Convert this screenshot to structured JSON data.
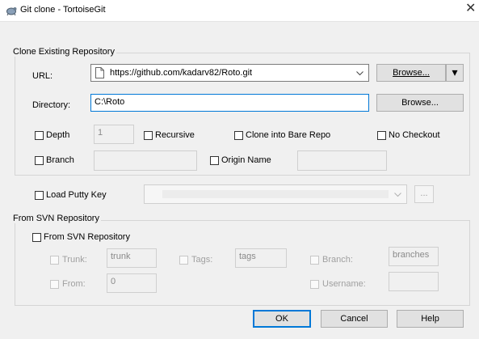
{
  "window": {
    "title": "Git clone - TortoiseGit",
    "close_glyph": "✕"
  },
  "clone": {
    "group_label": "Clone Existing Repository",
    "url_label": "URL:",
    "url_value": "https://github.com/kadarv82/Roto.git",
    "browse_main": "Browse...",
    "browse_split": "▾",
    "directory_label": "Directory:",
    "directory_value": "C:\\Roto",
    "browse_directory": "Browse...",
    "depth_label": "Depth",
    "depth_value": "1",
    "recursive_label": "Recursive",
    "bare_label": "Clone into Bare Repo",
    "nocheckout_label": "No Checkout",
    "branch_label": "Branch",
    "branch_value": "",
    "origin_label": "Origin Name",
    "origin_value": ""
  },
  "putty": {
    "label": "Load Putty Key",
    "value": "",
    "browse": "..."
  },
  "svn": {
    "group_label": "From SVN Repository",
    "checkbox_label": "From SVN Repository",
    "trunk_label": "Trunk:",
    "trunk_value": "trunk",
    "tags_label": "Tags:",
    "tags_value": "tags",
    "branch_label": "Branch:",
    "branch_value": "branches",
    "from_label": "From:",
    "from_value": "0",
    "username_label": "Username:",
    "username_value": ""
  },
  "buttons": {
    "ok": "OK",
    "cancel": "Cancel",
    "help": "Help"
  },
  "colors": {
    "focus": "#0078d7",
    "dialog_bg": "#f0f0f0",
    "titlebar_bg": "#ffffff"
  }
}
